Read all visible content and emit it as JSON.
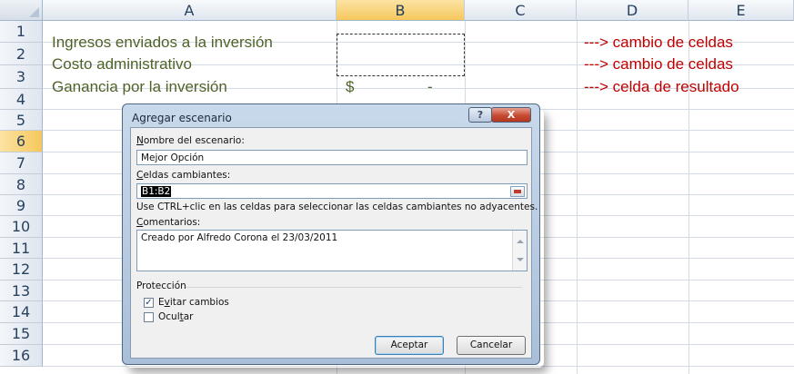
{
  "columns": [
    "A",
    "B",
    "C",
    "D",
    "E"
  ],
  "rows": [
    "1",
    "2",
    "3",
    "4",
    "5",
    "6",
    "7",
    "8",
    "9",
    "10",
    "11",
    "12",
    "13",
    "14",
    "15",
    "16"
  ],
  "cells": {
    "A1": "Ingresos enviados a la inversión",
    "A2": "Costo administrativo",
    "A3": "Ganancia por la inversión",
    "B3_currency": "$",
    "B3_value": "-",
    "D1": "---> cambio de celdas",
    "D2": "---> cambio de celdas",
    "D3": "---> celda de resultado"
  },
  "dialog": {
    "title": "Agregar escenario",
    "help_label": "?",
    "close_label": "X",
    "scenario_name_label": "Nombre del escenario:",
    "scenario_name_value": "Mejor Opción",
    "changing_cells_label": "Celdas cambiantes:",
    "changing_cells_value": "B1:B2",
    "hint": "Use CTRL+clic en las celdas para seleccionar las celdas cambiantes no adyacentes.",
    "comments_label": "Comentarios:",
    "comments_value": "Creado por Alfredo Corona el 23/03/2011",
    "protection_label": "Protección",
    "prevent_changes_label": "Evitar cambios",
    "prevent_changes_checked": true,
    "hide_label": "Ocultar",
    "hide_checked": false,
    "ok_label": "Aceptar",
    "cancel_label": "Cancelar"
  },
  "colors": {
    "label_text": "#4f6228",
    "annotation_text": "#c00000",
    "selected_header": "#f6c85c"
  }
}
